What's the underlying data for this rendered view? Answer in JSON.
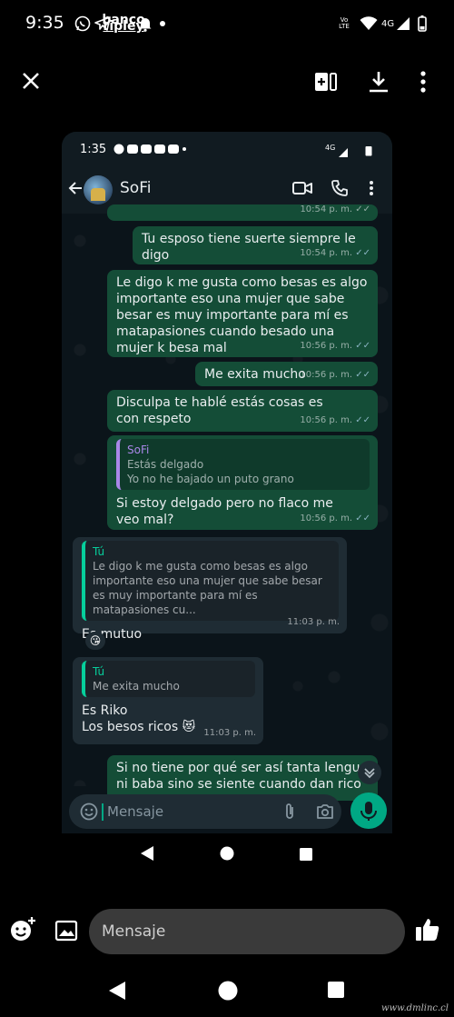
{
  "status_bar": {
    "time": "9:35",
    "bank_line1": "banco",
    "bank_line2": "ripley",
    "network": "4G",
    "volte": "Vo LTE"
  },
  "inner": {
    "status_time": "1:35",
    "network": "4G",
    "contact_name": "SoFi",
    "messages": [
      {
        "dir": "out",
        "text": "Tu esposo tiene suerte siempre le digo",
        "time": "10:54 p. m.",
        "ticks": "✓✓"
      },
      {
        "dir": "out",
        "text": "Le digo k me gusta como besas es algo importante eso una mujer que sabe besar es muy importante para mí es matapasiones cuando besado una mujer k besa mal",
        "time": "10:56 p. m.",
        "ticks": "✓✓"
      },
      {
        "dir": "out",
        "text": "Me exita mucho",
        "time": "10:56 p. m.",
        "ticks": "✓✓"
      },
      {
        "dir": "out",
        "text": "Disculpa te hablé estás cosas es con respeto",
        "time": "10:56 p. m.",
        "ticks": "✓✓"
      },
      {
        "dir": "out",
        "quote_name": "SoFi",
        "quote_lines": [
          "Estás delgado",
          "Yo no he bajado un puto grano"
        ],
        "text": "Si estoy delgado pero no flaco me veo mal?",
        "time": "10:56 p. m.",
        "ticks": "✓✓"
      },
      {
        "dir": "in",
        "quote_name": "Tú",
        "quote_text": "Le digo k me gusta como besas es algo importante eso una mujer que sabe besar es muy importante para mí es matapasiones cu...",
        "text": "Es mutuo",
        "time": "11:03 p. m.",
        "reaction": "😘"
      },
      {
        "dir": "in",
        "quote_name": "Tú",
        "quote_text": "Me exita mucho",
        "text_line1": "Es Riko",
        "text_line2": "Los besos ricos 😻",
        "time": "11:03 p. m."
      },
      {
        "dir": "out",
        "text": "Si no tiene por qué ser así tanta lengua ni baba sino se siente cuando dan rico los"
      }
    ],
    "input_placeholder": "Mensaje"
  },
  "bottom": {
    "message_placeholder": "Mensaje",
    "watermark": "www.dmlinc.cl"
  },
  "colors": {
    "outgoing_bubble": "#144d37",
    "incoming_bubble": "#1f2c34",
    "accent_green": "#00a884"
  }
}
